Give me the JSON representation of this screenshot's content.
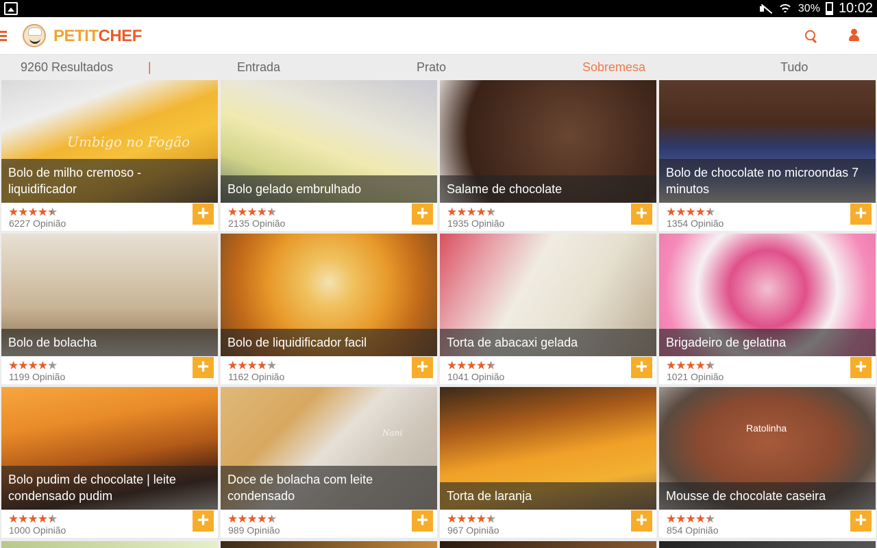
{
  "status_bar": {
    "battery": "30%",
    "time": "10:02"
  },
  "app": {
    "logo_part1": "PETIT",
    "logo_part2": "CHEF"
  },
  "tabs": {
    "results": "9260 Resultados",
    "divider": "|",
    "items": [
      "Entrada",
      "Prato",
      "Sobremesa",
      "Tudo"
    ],
    "active": "Sobremesa"
  },
  "colors": {
    "accent": "#e85d2a",
    "logo_yellow": "#f3a22d",
    "add_button": "#f7ad2a"
  },
  "recipes": [
    {
      "title": "Bolo de milho cremoso - liquidificador",
      "rating": 4.5,
      "opinions": "6227 Opinião",
      "watermark": "Umbigo no Fogão"
    },
    {
      "title": "Bolo gelado embrulhado",
      "rating": 4.5,
      "opinions": "2135 Opinião"
    },
    {
      "title": "Salame de chocolate",
      "rating": 4.5,
      "opinions": "1935 Opinião"
    },
    {
      "title": "Bolo de chocolate no microondas 7 minutos",
      "rating": 4.5,
      "opinions": "1354 Opinião"
    },
    {
      "title": "Bolo de bolacha",
      "rating": 4,
      "opinions": "1199 Opinião"
    },
    {
      "title": "Bolo de liquidificador facil",
      "rating": 4,
      "opinions": "1162 Opinião"
    },
    {
      "title": "Torta de abacaxi gelada",
      "rating": 4.5,
      "opinions": "1041 Opinião"
    },
    {
      "title": "Brigadeiro de gelatina",
      "rating": 4.5,
      "opinions": "1021 Opinião"
    },
    {
      "title": "Bolo pudim de chocolate | leite condensado pudim",
      "rating": 4.5,
      "opinions": "1000 Opinião"
    },
    {
      "title": "Doce de bolacha com leite condensado",
      "rating": 4.5,
      "opinions": "989 Opinião",
      "watermark": "Nani"
    },
    {
      "title": "Torta de laranja",
      "rating": 4.5,
      "opinions": "967 Opinião"
    },
    {
      "title": "Mousse de chocolate caseira",
      "rating": 4.5,
      "opinions": "854 Opinião",
      "watermark": "Ratolinha"
    }
  ]
}
